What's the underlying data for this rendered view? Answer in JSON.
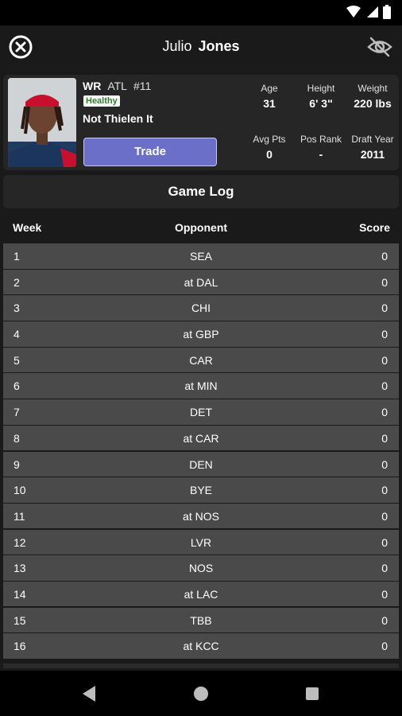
{
  "header": {
    "first_name": "Julio",
    "last_name": "Jones"
  },
  "player": {
    "position": "WR",
    "team": "ATL",
    "number": "#11",
    "status": "Healthy",
    "owner": "Not Thielen It",
    "trade_label": "Trade",
    "stats": [
      {
        "label": "Age",
        "value": "31"
      },
      {
        "label": "Height",
        "value": "6' 3\""
      },
      {
        "label": "Weight",
        "value": "220 lbs"
      },
      {
        "label": "Avg Pts",
        "value": "0"
      },
      {
        "label": "Pos Rank",
        "value": "-"
      },
      {
        "label": "Draft Year",
        "value": "2011"
      }
    ]
  },
  "game_log": {
    "title": "Game Log",
    "columns": {
      "week": "Week",
      "opponent": "Opponent",
      "score": "Score"
    },
    "rows": [
      {
        "week": "1",
        "opponent": "SEA",
        "score": "0"
      },
      {
        "week": "2",
        "opponent": "at DAL",
        "score": "0"
      },
      {
        "week": "3",
        "opponent": "CHI",
        "score": "0"
      },
      {
        "week": "4",
        "opponent": "at GBP",
        "score": "0"
      },
      {
        "week": "5",
        "opponent": "CAR",
        "score": "0"
      },
      {
        "week": "6",
        "opponent": "at MIN",
        "score": "0"
      },
      {
        "week": "7",
        "opponent": "DET",
        "score": "0"
      },
      {
        "week": "8",
        "opponent": "at CAR",
        "score": "0"
      },
      {
        "week": "9",
        "opponent": "DEN",
        "score": "0"
      },
      {
        "week": "10",
        "opponent": "BYE",
        "score": "0"
      },
      {
        "week": "11",
        "opponent": "at NOS",
        "score": "0"
      },
      {
        "week": "12",
        "opponent": "LVR",
        "score": "0"
      },
      {
        "week": "13",
        "opponent": "NOS",
        "score": "0"
      },
      {
        "week": "14",
        "opponent": "at LAC",
        "score": "0"
      },
      {
        "week": "15",
        "opponent": "TBB",
        "score": "0"
      },
      {
        "week": "16",
        "opponent": "at KCC",
        "score": "0"
      }
    ]
  },
  "colors": {
    "background": "#1a1a1a",
    "card": "#262626",
    "row": "#4a4a4a",
    "trade_button": "#6c6fc7",
    "healthy_text": "#2e7d32"
  },
  "icons": {
    "close": "close-circle-icon",
    "hide": "eye-off-icon",
    "wifi": "wifi-icon",
    "signal": "signal-icon",
    "battery": "battery-icon",
    "back": "back-triangle-icon",
    "home": "home-circle-icon",
    "recents": "recents-square-icon"
  }
}
